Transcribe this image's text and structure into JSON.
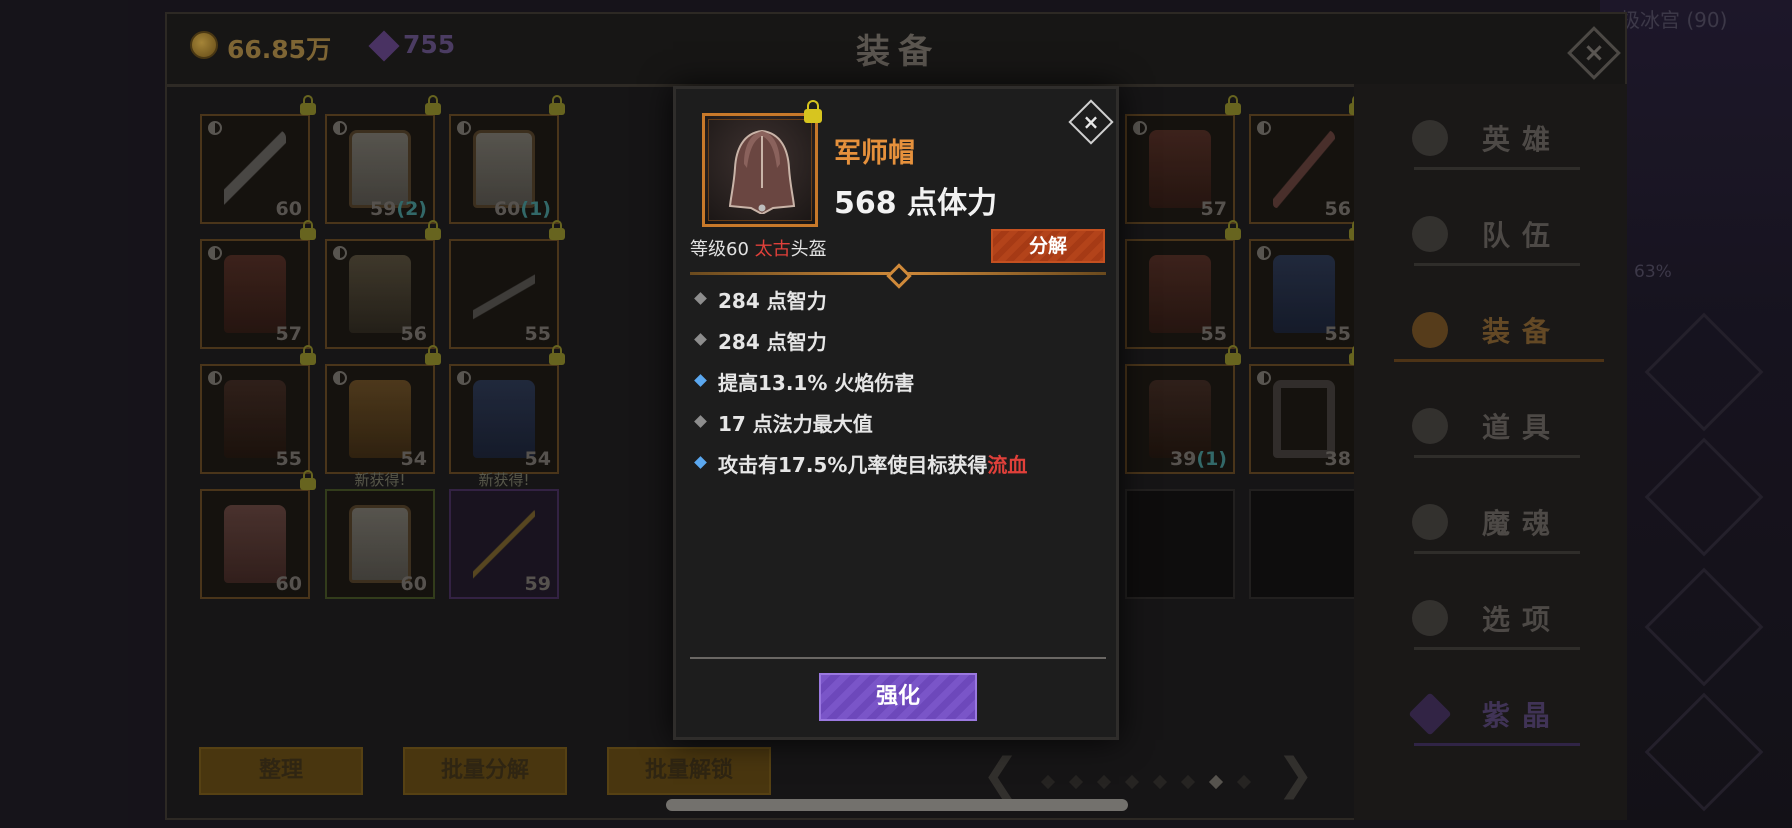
{
  "background": {
    "ghost_title": "极冰宫 (90)",
    "ghost_percent": "63%",
    "ghost_id": "0c64760d-0a2e-446a-8851"
  },
  "header": {
    "gold": "66.85万",
    "gems": "755",
    "title": "装备"
  },
  "grid": {
    "new_tag": "新获得!",
    "slots": [
      {
        "art": "sword",
        "level": "60",
        "count": "",
        "lock": true,
        "yin": true,
        "variant": ""
      },
      {
        "art": "robe",
        "level": "59",
        "count": "(2)",
        "lock": true,
        "yin": true,
        "variant": ""
      },
      {
        "art": "robe",
        "level": "60",
        "count": "(1)",
        "lock": true,
        "yin": true,
        "variant": ""
      },
      {
        "art": "armor",
        "level": "57",
        "count": "",
        "lock": true,
        "yin": true,
        "variant": ""
      },
      {
        "art": "dagger",
        "level": "56",
        "count": "",
        "lock": true,
        "yin": true,
        "variant": ""
      },
      {
        "art": "armor",
        "level": "57",
        "count": "",
        "lock": true,
        "yin": true,
        "variant": ""
      },
      {
        "art": "leaf",
        "level": "56",
        "count": "",
        "lock": true,
        "yin": true,
        "variant": ""
      },
      {
        "art": "knife",
        "level": "55",
        "count": "",
        "lock": true,
        "yin": false,
        "variant": ""
      },
      {
        "art": "armor",
        "level": "55",
        "count": "",
        "lock": true,
        "yin": false,
        "variant": ""
      },
      {
        "art": "blue",
        "level": "55",
        "count": "",
        "lock": true,
        "yin": true,
        "variant": ""
      },
      {
        "art": "boot",
        "level": "55",
        "count": "",
        "lock": true,
        "yin": true,
        "variant": ""
      },
      {
        "art": "gold",
        "level": "54",
        "count": "",
        "lock": true,
        "yin": true,
        "variant": ""
      },
      {
        "art": "blue",
        "level": "54",
        "count": "",
        "lock": true,
        "yin": true,
        "variant": ""
      },
      {
        "art": "boot",
        "level": "39",
        "count": "(1)",
        "lock": true,
        "yin": false,
        "variant": ""
      },
      {
        "art": "ring",
        "level": "38",
        "count": "",
        "lock": true,
        "yin": true,
        "variant": ""
      },
      {
        "art": "hood",
        "level": "60",
        "count": "",
        "lock": true,
        "yin": false,
        "variant": ""
      },
      {
        "art": "robe",
        "level": "60",
        "count": "",
        "lock": false,
        "yin": false,
        "variant": "green",
        "new": true
      },
      {
        "art": "spear",
        "level": "59",
        "count": "",
        "lock": false,
        "yin": false,
        "variant": "purple",
        "new": true
      }
    ]
  },
  "sidebar": {
    "items": [
      {
        "label": "英雄",
        "state": ""
      },
      {
        "label": "队伍",
        "state": ""
      },
      {
        "label": "装备",
        "state": "active"
      },
      {
        "label": "道具",
        "state": ""
      },
      {
        "label": "魔魂",
        "state": ""
      },
      {
        "label": "选项",
        "state": ""
      },
      {
        "label": "紫晶",
        "state": "violet"
      }
    ]
  },
  "bottom_bar": {
    "sort_label": "整理",
    "batch_decompose_label": "批量分解",
    "batch_unlock_label": "批量解锁",
    "prev_glyph": "❮",
    "next_glyph": "❯",
    "page_count": 8,
    "current_page": 7
  },
  "modal": {
    "close_glyph": "×",
    "item_name": "军师帽",
    "main_stat": "568 点体力",
    "meta": {
      "prefix": "等级60 ",
      "rarity": "太古",
      "type": "头盔"
    },
    "decompose_label": "分解",
    "stats": [
      {
        "text": "284 点智力",
        "bullet": "gray"
      },
      {
        "text": "284 点智力",
        "bullet": "gray"
      },
      {
        "text": "提高13.1% 火焰伤害",
        "bullet": "blue"
      },
      {
        "text": "17 点法力最大值",
        "bullet": "gray"
      },
      {
        "text": "攻击有17.5%几率使目标获得",
        "highlight": "流血",
        "bullet": "blue"
      }
    ],
    "upgrade_label": "强化"
  },
  "colors": {
    "item_name": "#e6913c",
    "rarity_red": "#e0403a",
    "decompose_orange": "#b3431a",
    "upgrade_purple": "#7a55c8",
    "bullet_blue": "#5ba8f0"
  }
}
